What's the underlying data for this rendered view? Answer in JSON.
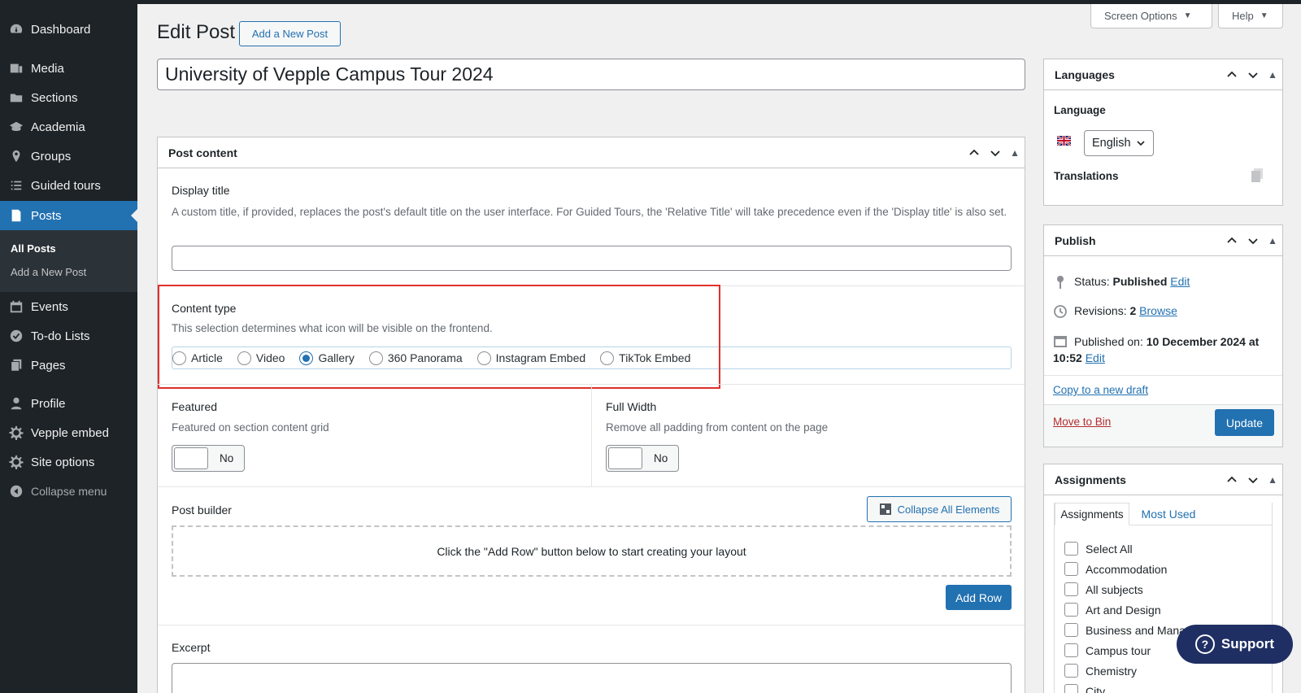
{
  "sidebar": {
    "items": [
      {
        "label": "Dashboard",
        "icon": "dashboard-icon"
      },
      {
        "label": "Media",
        "icon": "media-icon"
      },
      {
        "label": "Sections",
        "icon": "folder-icon"
      },
      {
        "label": "Academia",
        "icon": "graduation-cap-icon"
      },
      {
        "label": "Groups",
        "icon": "location-pin-icon"
      },
      {
        "label": "Guided tours",
        "icon": "list-icon"
      },
      {
        "label": "Posts",
        "icon": "posts-icon"
      },
      {
        "label": "Events",
        "icon": "calendar-icon"
      },
      {
        "label": "To-do Lists",
        "icon": "checkmark-icon"
      },
      {
        "label": "Pages",
        "icon": "pages-icon"
      },
      {
        "label": "Profile",
        "icon": "user-icon"
      },
      {
        "label": "Vepple embed",
        "icon": "gear-icon"
      },
      {
        "label": "Site options",
        "icon": "gear-icon"
      }
    ],
    "submenu": {
      "all_posts": "All Posts",
      "add_new": "Add a New Post"
    },
    "collapse": "Collapse menu"
  },
  "header": {
    "screen_options": "Screen Options",
    "help": "Help",
    "page_title": "Edit Post",
    "add_new_button": "Add a New Post"
  },
  "post_title": "University of Vepple Campus Tour 2024",
  "post_content": {
    "heading": "Post content",
    "display_title": {
      "label": "Display title",
      "description": "A custom title, if provided, replaces the post's default title on the user interface. For Guided Tours, the 'Relative Title' will take precedence even if the 'Display title' is also set.",
      "value": ""
    },
    "content_type": {
      "label": "Content type",
      "description": "This selection determines what icon will be visible on the frontend.",
      "options": [
        "Article",
        "Video",
        "Gallery",
        "360 Panorama",
        "Instagram Embed",
        "TikTok Embed"
      ],
      "selected": "Gallery"
    },
    "featured": {
      "label": "Featured",
      "description": "Featured on section content grid",
      "value": "No"
    },
    "full_width": {
      "label": "Full Width",
      "description": "Remove all padding from content on the page",
      "value": "No"
    },
    "post_builder": {
      "label": "Post builder",
      "collapse_button": "Collapse All Elements",
      "placeholder": "Click the \"Add Row\" button below to start creating your layout",
      "add_row": "Add Row"
    },
    "excerpt": {
      "label": "Excerpt"
    }
  },
  "languages": {
    "heading": "Languages",
    "language_label": "Language",
    "selected_language": "English",
    "translations_label": "Translations"
  },
  "publish": {
    "heading": "Publish",
    "status_label": "Status:",
    "status_value": "Published",
    "status_edit": "Edit",
    "revisions_label": "Revisions:",
    "revisions_value": "2",
    "revisions_link": "Browse",
    "published_label": "Published on:",
    "published_value_1": "10 December 2024 at",
    "published_value_2": "10:52",
    "published_edit": "Edit",
    "copy_draft": "Copy to a new draft",
    "move_bin": "Move to Bin",
    "update": "Update"
  },
  "assignments": {
    "heading": "Assignments",
    "tabs": [
      "Assignments",
      "Most Used"
    ],
    "items": [
      "Select All",
      "Accommodation",
      "All subjects",
      "Art and Design",
      "Business and Mana",
      "Campus tour",
      "Chemistry",
      "City"
    ]
  },
  "support": {
    "label": "Support"
  },
  "colors": {
    "accent": "#2271b1",
    "sidebar": "#1d2327",
    "highlight": "#e0302b",
    "support": "#1f2f63"
  }
}
